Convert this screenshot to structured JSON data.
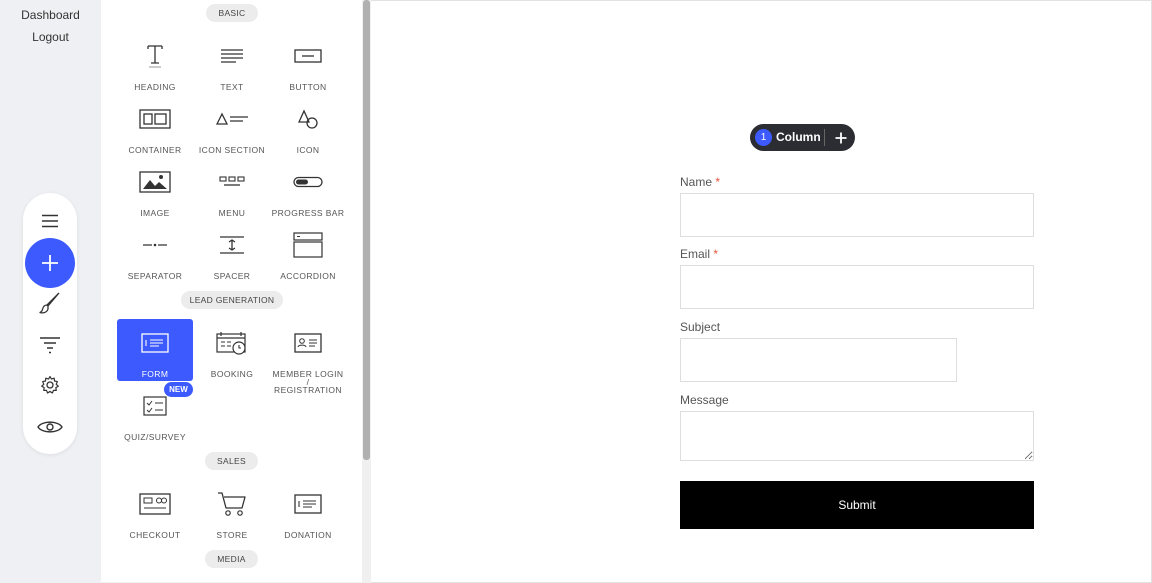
{
  "nav": {
    "dashboard": "Dashboard",
    "logout": "Logout"
  },
  "toolbar": {
    "items": [
      "hamburger-icon",
      "plus-icon",
      "brush-icon",
      "filter-icon",
      "gear-icon",
      "eye-icon"
    ],
    "accent": "#3d5afe"
  },
  "panel": {
    "sections": {
      "basic": "BASIC",
      "lead_generation": "LEAD GENERATION",
      "sales": "SALES",
      "media": "MEDIA"
    },
    "widgets": {
      "heading": "HEADING",
      "text": "TEXT",
      "button": "BUTTON",
      "container": "CONTAINER",
      "icon_section": "ICON SECTION",
      "icon": "ICON",
      "image": "IMAGE",
      "menu": "MENU",
      "progress_bar": "PROGRESS BAR",
      "separator": "SEPARATOR",
      "spacer": "SPACER",
      "accordion": "ACCORDION",
      "form": "FORM",
      "booking": "BOOKING",
      "member_login_line1": "MEMBER LOGIN /",
      "member_login_line2": "REGISTRATION",
      "quiz_survey": "QUIZ/SURVEY",
      "checkout": "CHECKOUT",
      "store": "STORE",
      "donation": "DONATION"
    },
    "new_badge": "NEW"
  },
  "canvas": {
    "column_pill": {
      "count": "1",
      "label": "Column"
    },
    "form": {
      "name_label": "Name",
      "email_label": "Email",
      "subject_label": "Subject",
      "message_label": "Message",
      "required_mark": "*",
      "submit_label": "Submit"
    }
  }
}
